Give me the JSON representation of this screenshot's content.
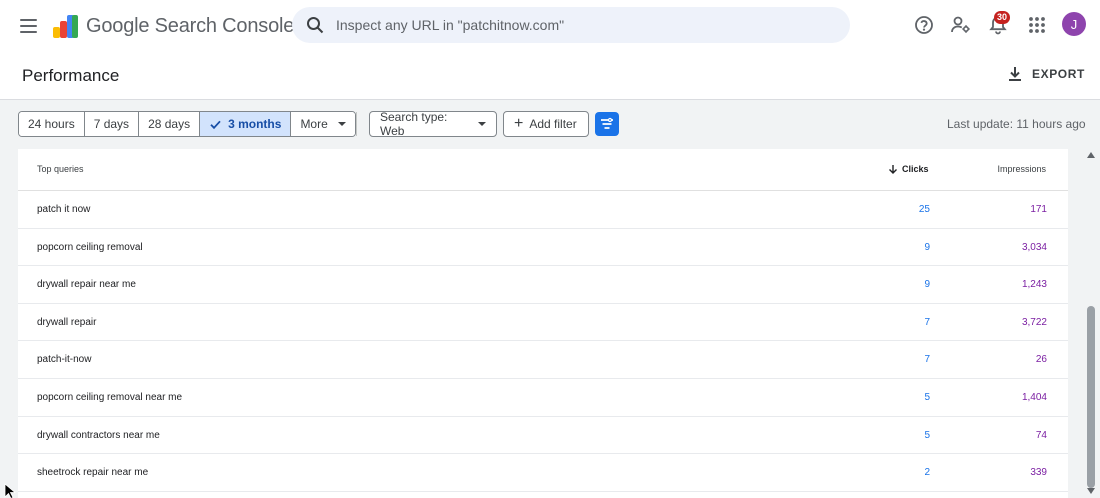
{
  "header": {
    "app_title": "Google Search Console",
    "search_placeholder": "Inspect any URL in \"patchitnow.com\"",
    "notification_count": "30",
    "avatar_letter": "J",
    "icons": [
      "menu-icon",
      "help-icon",
      "manage-users-icon",
      "notifications-icon",
      "apps-icon"
    ]
  },
  "page": {
    "title": "Performance",
    "export_label": "EXPORT"
  },
  "filters": {
    "date_ranges": [
      {
        "label": "24 hours",
        "active": false
      },
      {
        "label": "7 days",
        "active": false
      },
      {
        "label": "28 days",
        "active": false
      },
      {
        "label": "3 months",
        "active": true
      },
      {
        "label": "More",
        "active": false
      }
    ],
    "search_type": "Search type: Web",
    "add_filter": "Add filter",
    "last_update": "Last update: 11 hours ago"
  },
  "table": {
    "columns": {
      "query": "Top queries",
      "clicks": "Clicks",
      "impressions": "Impressions"
    },
    "rows": [
      {
        "query": "patch it now",
        "clicks": "25",
        "impressions": "171"
      },
      {
        "query": "popcorn ceiling removal",
        "clicks": "9",
        "impressions": "3,034"
      },
      {
        "query": "drywall repair near me",
        "clicks": "9",
        "impressions": "1,243"
      },
      {
        "query": "drywall repair",
        "clicks": "7",
        "impressions": "3,722"
      },
      {
        "query": "patch-it-now",
        "clicks": "7",
        "impressions": "26"
      },
      {
        "query": "popcorn ceiling removal near me",
        "clicks": "5",
        "impressions": "1,404"
      },
      {
        "query": "drywall contractors near me",
        "clicks": "5",
        "impressions": "74"
      },
      {
        "query": "sheetrock repair near me",
        "clicks": "2",
        "impressions": "339"
      }
    ]
  },
  "colors": {
    "clicks": "#1a73e8",
    "impressions": "#7b1fa2",
    "active_range_bg": "#d2e3fc",
    "avatar": "#8e44ad",
    "badge": "#c5221f"
  }
}
